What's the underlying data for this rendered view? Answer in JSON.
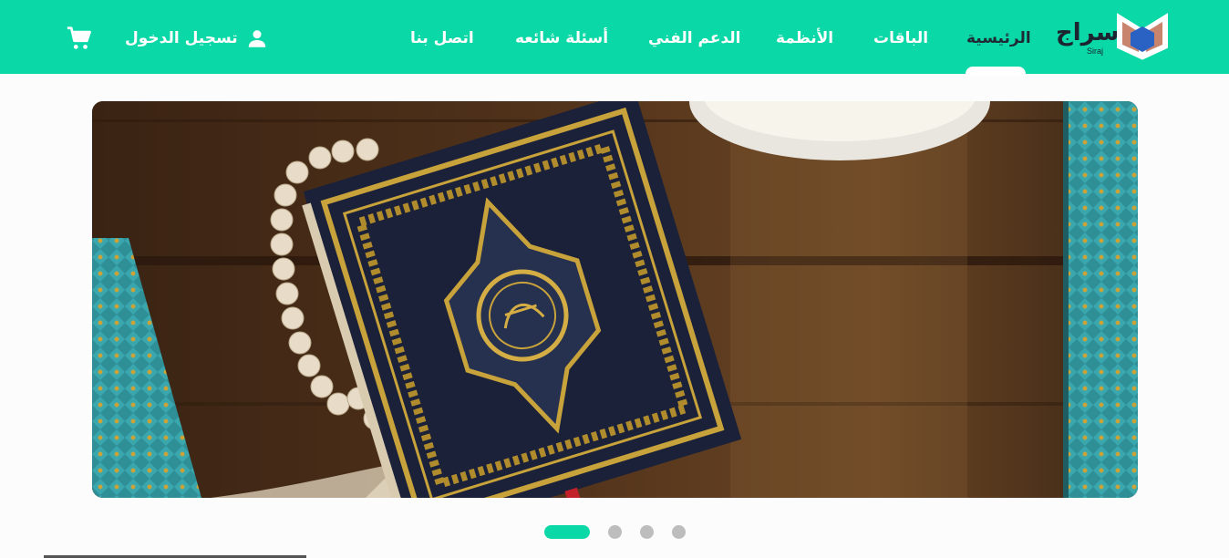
{
  "brand": {
    "name": "سراج",
    "sub": "Siraj",
    "primary_color": "#0ad8a6"
  },
  "nav": {
    "items": [
      {
        "label": "الرئيسية",
        "active": true
      },
      {
        "label": "الباقات"
      },
      {
        "label": "الأنظمة"
      },
      {
        "label": "الدعم الفني"
      },
      {
        "label": "أسئلة شائعه"
      },
      {
        "label": "اتصل بنا"
      }
    ],
    "login_label": "تسجيل الدخول",
    "login_icon": "person-icon",
    "cart_icon": "cart-icon"
  },
  "hero": {
    "image": "quran-and-prayer-beads-on-wooden-table",
    "slide_count": 4,
    "active_slide": 1
  }
}
